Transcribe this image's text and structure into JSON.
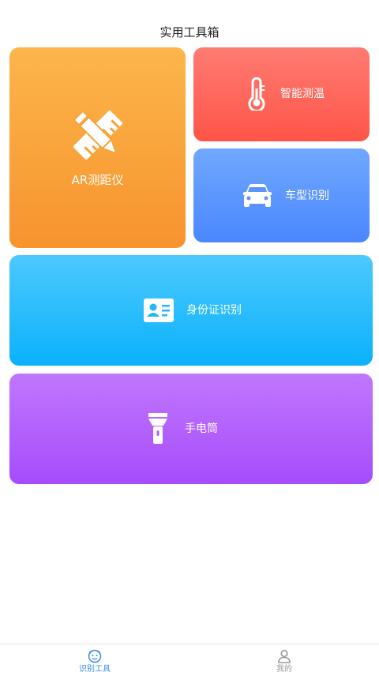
{
  "header": {
    "title": "实用工具箱"
  },
  "tools": {
    "ar": {
      "label": "AR测距仪",
      "icon": "pencil-ruler-icon",
      "color_top": "#fcb64b",
      "color_bottom": "#f7932e"
    },
    "temperature": {
      "label": "智能测温",
      "icon": "thermometer-icon",
      "color_top": "#ff7b72",
      "color_bottom": "#ff5548"
    },
    "car": {
      "label": "车型识别",
      "icon": "car-icon",
      "color_top": "#70a8ff",
      "color_bottom": "#4a87fd"
    },
    "id_card": {
      "label": "身份证识别",
      "icon": "id-card-icon",
      "color_top": "#4dc9fe",
      "color_bottom": "#0bb1fb"
    },
    "flashlight": {
      "label": "手电筒",
      "icon": "flashlight-icon",
      "color_top": "#c177fd",
      "color_bottom": "#a64cfc"
    }
  },
  "tabbar": {
    "items": [
      {
        "label": "识别工具",
        "icon": "face-scan-icon",
        "active": true,
        "color": "#3b8ee8"
      },
      {
        "label": "我的",
        "icon": "user-icon",
        "active": false,
        "color": "#9a9a9a"
      }
    ]
  }
}
